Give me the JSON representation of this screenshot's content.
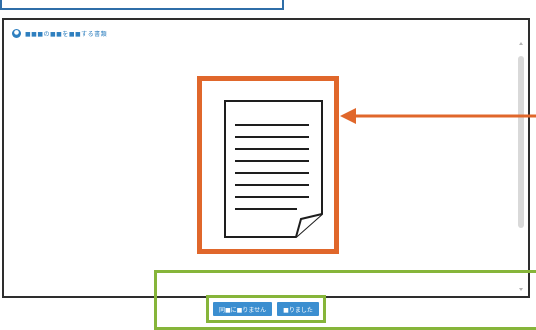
{
  "window": {
    "title": "■■■の■■を■■する書類"
  },
  "footer": {
    "buttons": [
      {
        "label": "同■に■りません"
      },
      {
        "label": "■りました"
      }
    ]
  },
  "colors": {
    "document_highlight": "#e0672b",
    "footer_highlight": "#86b53a",
    "button": "#3b8ed0",
    "title_accent": "#2e7fbf"
  },
  "icons": {
    "title": "circle-info-icon",
    "document": "document-page-icon",
    "pointer": "arrow-left-icon"
  }
}
